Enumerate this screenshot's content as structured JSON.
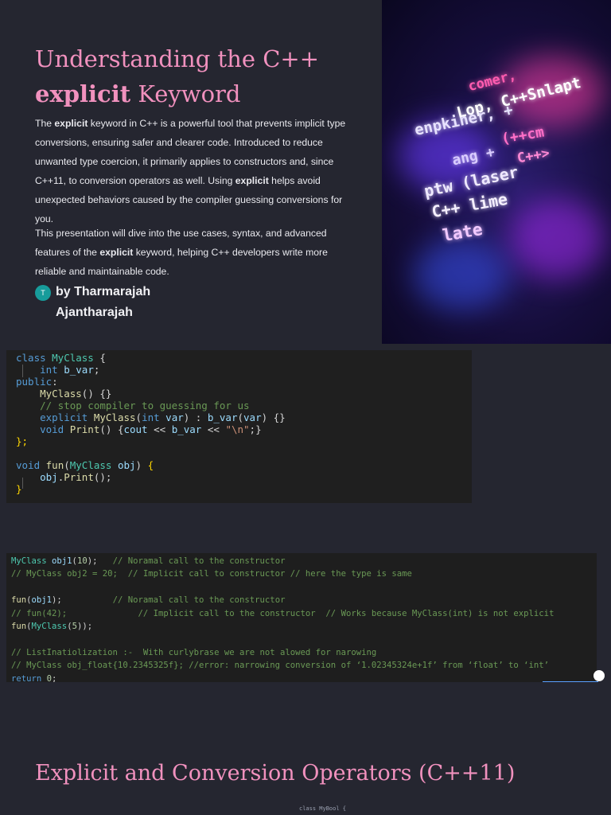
{
  "title": {
    "line1": "Understanding the C++",
    "bold": "explicit",
    "rest": " Keyword"
  },
  "intro": {
    "p1": [
      {
        "t": "The "
      },
      {
        "t": "explicit",
        "b": true
      },
      {
        "t": " keyword in C++ is a powerful tool that prevents implicit type conversions, ensuring safer and clearer code. Introduced to reduce unwanted type coercion, it primarily applies to constructors and, since C++11, to conversion operators as well. Using "
      },
      {
        "t": "explicit",
        "b": true
      },
      {
        "t": " helps avoid unexpected behaviors caused by the compiler guessing conversions for you."
      }
    ],
    "p2": [
      {
        "t": "This presentation will dive into the use cases, syntax, and advanced features of the "
      },
      {
        "t": "explicit",
        "b": true
      },
      {
        "t": " keyword, helping C++ developers write more reliable and maintainable code."
      }
    ]
  },
  "author": {
    "initial": "T",
    "name": "by Tharmarajah Ajantharajah"
  },
  "hero_image": {
    "icon": "code-photo-icon",
    "words": [
      "comer,",
      "Lop, C++Snlapt",
      "enpkiner, +",
      "(++cm",
      "ang +",
      "C++>",
      "ptw (laser",
      "C++ lime",
      "late"
    ]
  },
  "code_block_1": {
    "lines": [
      [
        [
          "class ",
          "kw"
        ],
        [
          "MyClass ",
          "ty"
        ],
        [
          "{",
          "pu"
        ]
      ],
      [
        [
          "    int ",
          "kw"
        ],
        [
          "b_var",
          "var"
        ],
        [
          ";",
          "pu"
        ]
      ],
      [
        [
          "public",
          "kw"
        ],
        [
          ":",
          "pu"
        ]
      ],
      [
        [
          "    MyClass",
          "fn"
        ],
        [
          "() {}",
          "pu"
        ]
      ],
      [
        [
          "    // stop compiler to guessing for us",
          "cm"
        ]
      ],
      [
        [
          "    explicit ",
          "kw"
        ],
        [
          "MyClass",
          "fn"
        ],
        [
          "(",
          "pu"
        ],
        [
          "int ",
          "kw"
        ],
        [
          "var",
          "var"
        ],
        [
          ") : ",
          "pu"
        ],
        [
          "b_var",
          "var"
        ],
        [
          "(",
          "pu"
        ],
        [
          "var",
          "var"
        ],
        [
          ") {}",
          "pu"
        ]
      ],
      [
        [
          "    void ",
          "kw"
        ],
        [
          "Print",
          "fn"
        ],
        [
          "() {",
          "pu"
        ],
        [
          "cout ",
          "var"
        ],
        [
          "<< ",
          "pu"
        ],
        [
          "b_var ",
          "var"
        ],
        [
          "<< ",
          "pu"
        ],
        [
          "\"\\n\"",
          "str"
        ],
        [
          ";}",
          "pu"
        ]
      ],
      [
        [
          "};",
          "br"
        ]
      ],
      [
        [
          "",
          ""
        ]
      ],
      [
        [
          "void ",
          "kw"
        ],
        [
          "fun",
          "fn"
        ],
        [
          "(",
          "pu"
        ],
        [
          "MyClass ",
          "ty"
        ],
        [
          "obj",
          "var"
        ],
        [
          ") ",
          "pu"
        ],
        [
          "{",
          "br"
        ]
      ],
      [
        [
          "    obj",
          "var"
        ],
        [
          ".",
          "pu"
        ],
        [
          "Print",
          "fn"
        ],
        [
          "();",
          "pu"
        ]
      ],
      [
        [
          "}",
          "br"
        ]
      ]
    ]
  },
  "code_block_2": {
    "lines": [
      [
        [
          "MyClass ",
          "ty"
        ],
        [
          "obj1",
          "var"
        ],
        [
          "(",
          "pu"
        ],
        [
          "10",
          "num"
        ],
        [
          ");   ",
          "pu"
        ],
        [
          "// Noramal call to the constructor",
          "cm"
        ]
      ],
      [
        [
          "// MyClass obj2 = 20;  // Implicit call to constructor // here the type is same",
          "cm"
        ]
      ],
      [
        [
          "",
          ""
        ]
      ],
      [
        [
          "fun",
          "fn"
        ],
        [
          "(",
          "pu"
        ],
        [
          "obj1",
          "var"
        ],
        [
          ");          ",
          "pu"
        ],
        [
          "// Noramal call to the constructor",
          "cm"
        ]
      ],
      [
        [
          "// fun(42);              // Implicit call to the constructor  // Works because MyClass(int) is not explicit",
          "cm"
        ]
      ],
      [
        [
          "fun",
          "fn"
        ],
        [
          "(",
          "pu"
        ],
        [
          "MyClass",
          "ty"
        ],
        [
          "(",
          "pu"
        ],
        [
          "5",
          "num"
        ],
        [
          "));",
          "pu"
        ]
      ],
      [
        [
          "",
          ""
        ]
      ],
      [
        [
          "// ListInatiolization :-  With curlybrase we are not alowed for narowing",
          "cm"
        ]
      ],
      [
        [
          "// MyClass obj_float{10.2345325f}; //error: narrowing conversion of ‘1.02345324e+1f’ from ‘float’ to ‘int’",
          "cm"
        ]
      ],
      [
        [
          "return ",
          "kw"
        ],
        [
          "0",
          "num"
        ],
        [
          ";",
          "pu"
        ]
      ]
    ]
  },
  "section": {
    "title": "Explicit and Conversion Operators (C++11)",
    "code_preview": "class MyBool {"
  },
  "colors": {
    "accent_pink": "#f191be",
    "background": "#252630",
    "avatar_teal": "#179c9b"
  }
}
